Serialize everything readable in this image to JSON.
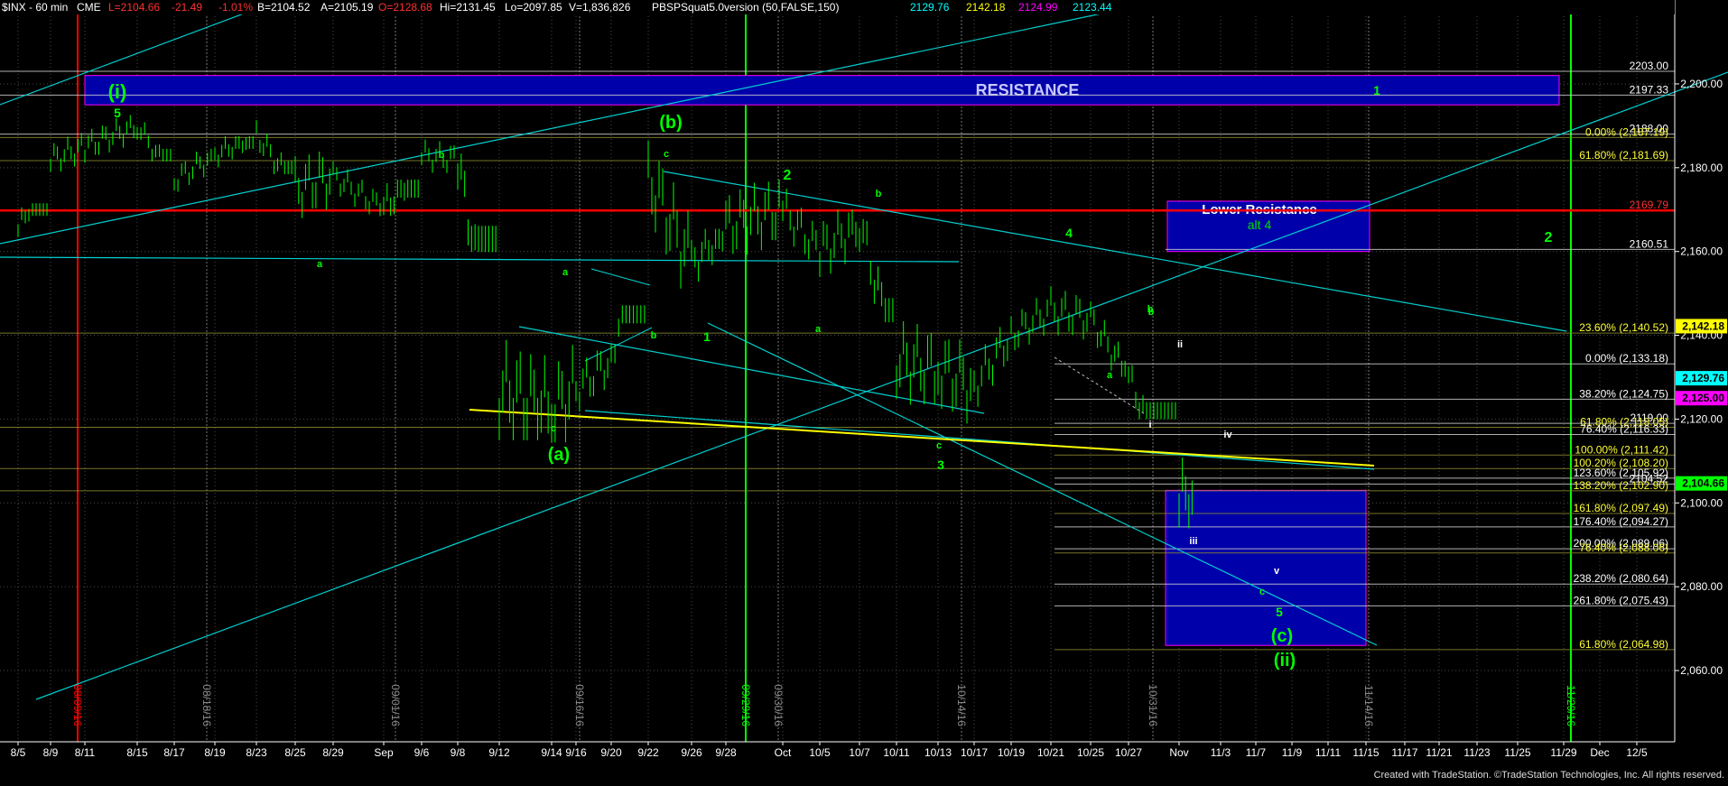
{
  "header": {
    "symbol": "$INX - 60 min",
    "exchange": "CME",
    "last": "L=2104.66",
    "change": "-21.49",
    "change_pct": "-1.01%",
    "bid": "B=2104.52",
    "ask": "A=2105.19",
    "open": "O=2128.68",
    "high": "Hi=2131.45",
    "low": "Lo=2097.85",
    "volume": "V=1,836,826",
    "indicator": "PBSPSquat5.0version (50,FALSE,150)",
    "ind_vals": [
      {
        "text": "2129.76",
        "color": "#00ffff"
      },
      {
        "text": "2142.18",
        "color": "#ffff00"
      },
      {
        "text": "2124.99",
        "color": "#ff00ff"
      },
      {
        "text": "2123.44",
        "color": "#00ffff"
      }
    ]
  },
  "footer": {
    "credit": "Created with TradeStation. ©TradeStation Technologies, Inc. All rights reserved."
  },
  "colors": {
    "background": "#000000",
    "bars": "#00ff00",
    "grid": "#4a4a4a",
    "resistance": "#0000aa",
    "red_line": "#ff0000",
    "channel": "#00d0d0",
    "yellow": "#ffff00",
    "label_green": "#00ff00",
    "fib": "#ffffff"
  },
  "chart_data": {
    "type": "line",
    "title": "$INX - 60 min",
    "xlabel": "",
    "ylabel": "",
    "ylim": [
      2043,
      2217
    ],
    "x_ticks": [
      "8/5",
      "8/9",
      "8/11",
      "8/15",
      "8/17",
      "8/19",
      "8/23",
      "8/25",
      "8/29",
      "Sep",
      "9/6",
      "9/8",
      "9/12",
      "9/14",
      "9/16",
      "9/20",
      "9/22",
      "9/26",
      "9/28",
      "Oct",
      "10/5",
      "10/7",
      "10/11",
      "10/13",
      "10/17",
      "10/19",
      "10/21",
      "10/25",
      "10/27",
      "Nov",
      "11/3",
      "11/7",
      "11/9",
      "11/11",
      "11/15",
      "11/17",
      "11/21",
      "11/23",
      "11/25",
      "11/29",
      "Dec",
      "12/5"
    ],
    "y_ticks": [
      2060,
      2080,
      2100,
      2120,
      2140,
      2160,
      2180,
      2200
    ],
    "y_tick_labels": [
      "2,060.00",
      "2,080.00",
      "2,100.00",
      "2,120.00",
      "2,140.00",
      "2,160.00",
      "2,180.00",
      "2,200.00"
    ],
    "date_markers": [
      {
        "label": "08/09/16",
        "color": "#ff0000"
      },
      {
        "label": "08/18/16",
        "color": "#8a8a8a"
      },
      {
        "label": "09/01/16",
        "color": "#8a8a8a"
      },
      {
        "label": "09/16/16",
        "color": "#8a8a8a"
      },
      {
        "label": "09/29/16",
        "color": "#00ff00"
      },
      {
        "label": "09/30/16",
        "color": "#8a8a8a"
      },
      {
        "label": "10/14/16",
        "color": "#8a8a8a"
      },
      {
        "label": "10/31/16",
        "color": "#8a8a8a"
      },
      {
        "label": "11/14/16",
        "color": "#8a8a8a"
      },
      {
        "label": "11/29/16",
        "color": "#00ff00"
      }
    ],
    "series": [
      {
        "x": [
          "8/5",
          "8/9",
          "8/11",
          "8/15",
          "8/17",
          "8/19",
          "8/23",
          "8/25",
          "8/29",
          "Sep",
          "9/6",
          "9/8",
          "9/12",
          "9/14",
          "9/16",
          "9/20",
          "9/22",
          "9/26",
          "9/28",
          "Oct",
          "10/5",
          "10/7",
          "10/11",
          "10/13",
          "10/17",
          "10/19",
          "10/21",
          "10/25",
          "10/27",
          "Nov"
        ],
        "values": [
          2165,
          2182,
          2185,
          2190,
          2177,
          2183,
          2188,
          2175,
          2178,
          2170,
          2183,
          2182,
          2127,
          2122,
          2127,
          2134,
          2178,
          2157,
          2166,
          2170,
          2160,
          2167,
          2134,
          2132,
          2128,
          2140,
          2146,
          2144,
          2130,
          2101
        ],
        "low": [
          2158,
          2175,
          2178,
          2183,
          2171,
          2176,
          2180,
          2160,
          2170,
          2157,
          2176,
          2163,
          2120,
          2119,
          2120,
          2127,
          2145,
          2143,
          2147,
          2158,
          2142,
          2146,
          2127,
          2114,
          2124,
          2131,
          2136,
          2132,
          2122,
          2098
        ],
        "high": [
          2170,
          2188,
          2191,
          2194,
          2183,
          2186,
          2193,
          2186,
          2183,
          2175,
          2189,
          2189,
          2162,
          2157,
          2140,
          2145,
          2182,
          2163,
          2175,
          2178,
          2167,
          2170,
          2160,
          2147,
          2145,
          2148,
          2155,
          2148,
          2139,
          2132
        ]
      }
    ],
    "levels": [
      {
        "value": 2203.0,
        "label": "2203.00"
      },
      {
        "value": 2197.33,
        "label": "2197.33"
      },
      {
        "value": 2188.0,
        "label": "2188.00"
      },
      {
        "value": 2187.19,
        "label": "0.00% (2,187.19)",
        "color": "#ffff00"
      },
      {
        "value": 2181.69,
        "label": "61.80% (2,181.69)",
        "color": "#ffff00"
      },
      {
        "value": 2169.79,
        "label": "2169.79",
        "color": "#ff0000"
      },
      {
        "value": 2160.51,
        "label": "2160.51"
      },
      {
        "value": 2140.52,
        "label": "23.60% (2,140.52)",
        "color": "#ffff00"
      },
      {
        "value": 2133.18,
        "label": "0.00% (2,133.18)"
      },
      {
        "value": 2124.75,
        "label": "38.20% (2,124.75)"
      },
      {
        "value": 2119.0,
        "label": "2119.00"
      },
      {
        "value": 2118.05,
        "label": "61.80% (2,118.05)",
        "color": "#ffff00"
      },
      {
        "value": 2116.33,
        "label": "76.40% (2,116.33)"
      },
      {
        "value": 2111.42,
        "label": "100.00% (2,111.42)",
        "color": "#ffff00"
      },
      {
        "value": 2108.2,
        "label": "100.20% (2,108.20)",
        "color": "#ffff00"
      },
      {
        "value": 2105.92,
        "label": "123.60% (2,105.92)"
      },
      {
        "value": 2104.52,
        "label": "2104.52"
      },
      {
        "value": 2102.9,
        "label": "138.20% (2,102.90)",
        "color": "#ffff00"
      },
      {
        "value": 2097.49,
        "label": "161.80% (2,097.49)",
        "color": "#ffff00"
      },
      {
        "value": 2094.27,
        "label": "176.40% (2,094.27)"
      },
      {
        "value": 2089.06,
        "label": "200.00% (2,089.06)"
      },
      {
        "value": 2088.06,
        "label": "76.40% (2,088.06)",
        "color": "#ffff00"
      },
      {
        "value": 2080.64,
        "label": "238.20% (2,080.64)"
      },
      {
        "value": 2075.43,
        "label": "261.80% (2,075.43)"
      },
      {
        "value": 2064.98,
        "label": "61.80% (2,064.98)",
        "color": "#ffff00"
      }
    ],
    "price_tags": [
      {
        "value": 2142.18,
        "label": "2,142.18",
        "color": "#ffff00",
        "text_color": "#000000"
      },
      {
        "value": 2129.76,
        "label": "2,129.76",
        "color": "#00ffff",
        "text_color": "#000000"
      },
      {
        "value": 2125.0,
        "label": "2,125.00",
        "color": "#ff00ff",
        "text_color": "#000000"
      },
      {
        "value": 2104.66,
        "label": "2,104.66",
        "color": "#00ff00",
        "text_color": "#000000"
      }
    ],
    "zones": [
      {
        "label": "RESISTANCE",
        "sublabel": ""
      },
      {
        "label": "Lower Resistance",
        "sublabel": "alt 4"
      },
      {
        "label": "",
        "sublabel": ""
      }
    ],
    "wave_labels": [
      "(i)",
      "5",
      "b",
      "a",
      "(b)",
      "c",
      "2",
      "b",
      "(a)",
      "c",
      "a",
      "b",
      "1",
      "a",
      "b",
      "3",
      "c",
      "4",
      "b",
      "a",
      "ii",
      "i",
      "iv",
      "iii",
      "v",
      "c",
      "5",
      "(c)",
      "(ii)",
      "1",
      "2"
    ]
  }
}
